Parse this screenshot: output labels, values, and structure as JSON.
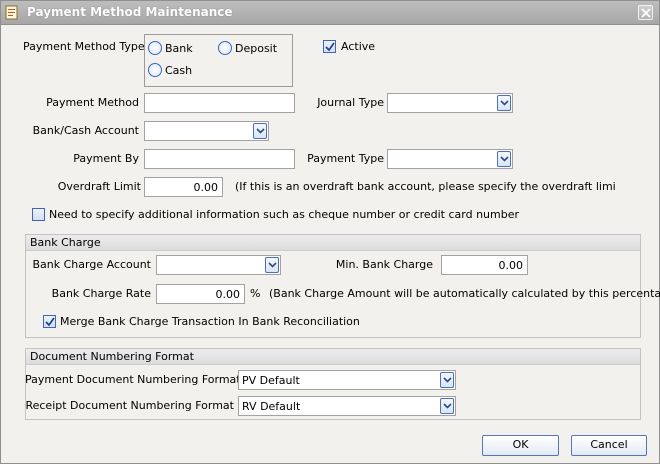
{
  "window": {
    "title": "Payment Method Maintenance"
  },
  "payment_method_type": {
    "label": "Payment Method Type",
    "options": [
      "Bank",
      "Deposit",
      "Cash"
    ]
  },
  "active": {
    "label": "Active",
    "checked": true
  },
  "fields": {
    "payment_method_label": "Payment Method",
    "payment_method_value": "",
    "journal_type_label": "Journal Type",
    "journal_type_value": "",
    "bank_cash_account_label": "Bank/Cash Account",
    "bank_cash_account_value": "",
    "payment_by_label": "Payment By",
    "payment_by_value": "",
    "payment_type_label": "Payment Type",
    "payment_type_value": "",
    "overdraft_limit_label": "Overdraft Limit",
    "overdraft_limit_value": "0.00",
    "overdraft_note": "(If this is an overdraft bank account, please specify the overdraft limi"
  },
  "additional_info": {
    "label": "Need to specify additional information such as cheque number or credit card number",
    "checked": false
  },
  "bank_charge": {
    "header": "Bank Charge",
    "account_label": "Bank Charge Account",
    "account_value": "",
    "min_label": "Min. Bank Charge",
    "min_value": "0.00",
    "rate_label": "Bank Charge Rate",
    "rate_value": "0.00",
    "rate_unit": "%",
    "rate_note": "(Bank Charge Amount will be automatically calculated by this percentage",
    "merge_label": "Merge Bank Charge Transaction In Bank Reconciliation",
    "merge_checked": true
  },
  "doc_numbering": {
    "header": "Document Numbering Format",
    "payment_label": "Payment Document Numbering Format",
    "payment_value": "PV Default",
    "receipt_label": "Receipt Document Numbering Format",
    "receipt_value": "RV Default"
  },
  "buttons": {
    "ok": "OK",
    "cancel": "Cancel"
  },
  "icons": {
    "title": "form-icon",
    "close": "close-icon",
    "dropdown": "chevron-down-icon",
    "check": "check-icon"
  }
}
